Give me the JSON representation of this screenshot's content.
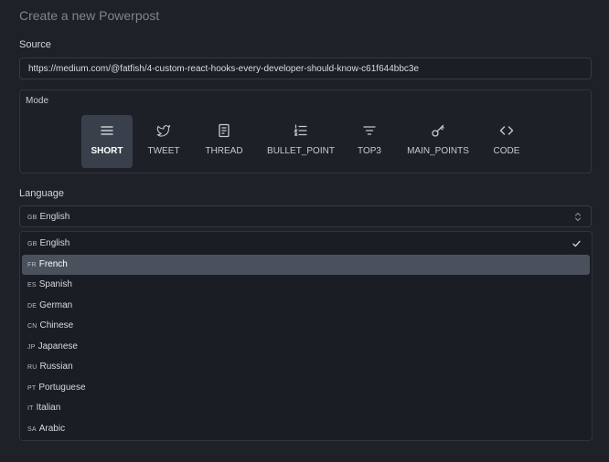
{
  "page": {
    "title": "Create a new Powerpost"
  },
  "source": {
    "label": "Source",
    "value": "https://medium.com/@fatfish/4-custom-react-hooks-every-developer-should-know-c61f644bbc3e"
  },
  "mode": {
    "label": "Mode",
    "items": [
      {
        "label": "SHORT",
        "icon": "menu-lines-icon",
        "active": true
      },
      {
        "label": "TWEET",
        "icon": "twitter-bird-icon",
        "active": false
      },
      {
        "label": "THREAD",
        "icon": "document-icon",
        "active": false
      },
      {
        "label": "BULLET_POINT",
        "icon": "numbered-list-icon",
        "active": false
      },
      {
        "label": "TOP3",
        "icon": "filter-icon",
        "active": false
      },
      {
        "label": "MAIN_POINTS",
        "icon": "key-icon",
        "active": false
      },
      {
        "label": "CODE",
        "icon": "code-brackets-icon",
        "active": false
      }
    ]
  },
  "language": {
    "label": "Language",
    "selected": {
      "flag": "GB",
      "name": "English"
    },
    "options": [
      {
        "flag": "GB",
        "name": "English",
        "selected": true,
        "highlighted": false
      },
      {
        "flag": "FR",
        "name": "French",
        "selected": false,
        "highlighted": true
      },
      {
        "flag": "ES",
        "name": "Spanish",
        "selected": false,
        "highlighted": false
      },
      {
        "flag": "DE",
        "name": "German",
        "selected": false,
        "highlighted": false
      },
      {
        "flag": "CN",
        "name": "Chinese",
        "selected": false,
        "highlighted": false
      },
      {
        "flag": "JP",
        "name": "Japanese",
        "selected": false,
        "highlighted": false
      },
      {
        "flag": "RU",
        "name": "Russian",
        "selected": false,
        "highlighted": false
      },
      {
        "flag": "PT",
        "name": "Portuguese",
        "selected": false,
        "highlighted": false
      },
      {
        "flag": "IT",
        "name": "Italian",
        "selected": false,
        "highlighted": false
      },
      {
        "flag": "SA",
        "name": "Arabic",
        "selected": false,
        "highlighted": false
      }
    ]
  },
  "colors": {
    "background": "#1e2128",
    "active_mode_bg": "#3a404b",
    "highlight_bg": "#4a505c",
    "text": "#d7dae0",
    "muted": "#7e8590"
  }
}
